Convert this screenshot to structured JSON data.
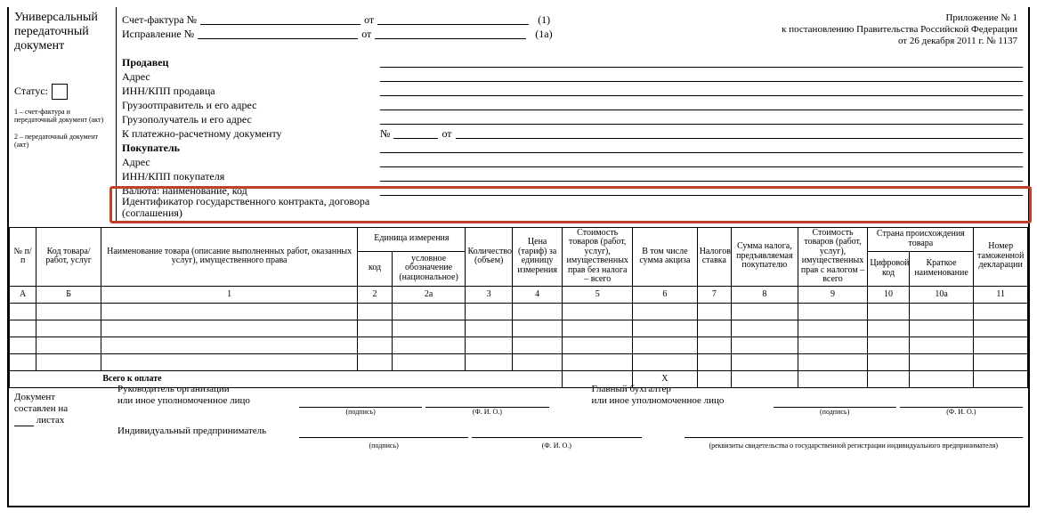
{
  "doc_type": {
    "l1": "Универсальный",
    "l2": "передаточный",
    "l3": "документ"
  },
  "status_label": "Статус:",
  "footnotes": {
    "fn1": "1 – счет-фактура и передаточный документ (акт)",
    "fn2": "2 – передаточный документ (акт)"
  },
  "header": {
    "invoice_label": "Счет-фактура №",
    "correction_label": "Исправление №",
    "from": "от",
    "p1": "(1)",
    "p1a": "(1а)"
  },
  "right_note": {
    "l1": "Приложение № 1",
    "l2": "к постановлению Правительства Российской Федерации",
    "l3": "от 26 декабря 2011 г. № 1137"
  },
  "fields": {
    "seller": "Продавец",
    "address": "Адрес",
    "inn_seller": "ИНН/КПП продавца",
    "consignor": "Грузоотправитель и его адрес",
    "consignee": "Грузополучатель и его адрес",
    "payment_doc": "К платежно-расчетному документу",
    "payment_doc_no": "№",
    "payment_doc_from": "от",
    "buyer": "Покупатель",
    "address_buyer": "Адрес",
    "inn_buyer": "ИНН/КПП покупателя",
    "currency": "Валюта: наименование, код",
    "gov_contract_l1": "Идентификатор государственного контракта, договора",
    "gov_contract_l2": "(соглашения)"
  },
  "table": {
    "head": {
      "no": "№ п/п",
      "goods_code": "Код товара/ работ, услуг",
      "name": "Наименование товара (описание выполненных работ, оказанных услуг), имущественного права",
      "unit_group": "Единица измерения",
      "unit_code": "код",
      "unit_name": "условное обозначение (национальное)",
      "qty": "Количество (объем)",
      "price": "Цена (тариф) за единицу измерения",
      "cost_no_tax": "Стоимость товаров (работ, услуг), имущественных прав без налога – всего",
      "excise": "В том числе сумма акциза",
      "tax_rate": "Налоговая ставка",
      "tax_amount": "Сумма налога, предъявляемая покупателю",
      "cost_with_tax": "Стоимость товаров (работ, услуг), имущественных прав с налогом – всего",
      "country_group": "Страна происхождения товара",
      "country_code": "Цифровой код",
      "country_name": "Краткое наименование",
      "decl_no": "Номер таможенной декларации"
    },
    "col_nums": {
      "A": "А",
      "B": "Б",
      "c1": "1",
      "c2": "2",
      "c2a": "2а",
      "c3": "3",
      "c4": "4",
      "c5": "5",
      "c6": "6",
      "c7": "7",
      "c8": "8",
      "c9": "9",
      "c10": "10",
      "c10a": "10а",
      "c11": "11"
    },
    "total_label": "Всего к оплате",
    "total_x": "Х"
  },
  "footer": {
    "doc_on_sheets_l1": "Документ",
    "doc_on_sheets_l2": "составлен на",
    "doc_on_sheets_l3": "листах",
    "head_org_l1": "Руководитель организации",
    "head_org_l2": "или иное уполномоченное лицо",
    "chief_acc_l1": "Главный бухгалтер",
    "chief_acc_l2": "или иное уполномоченное лицо",
    "ind_pred": "Индивидуальный предприниматель",
    "sig": "(подпись)",
    "fio": "(Ф. И. О.)",
    "rekv": "(реквизиты свидетельства о государственной регистрации индивидуального предпринимателя)"
  }
}
